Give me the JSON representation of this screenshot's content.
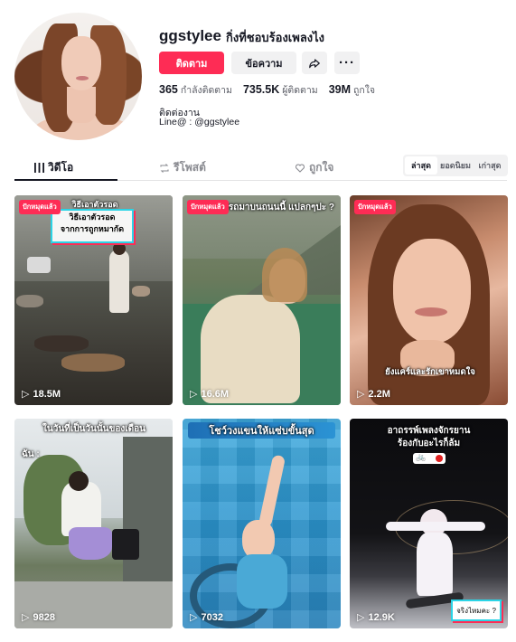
{
  "profile": {
    "username": "ggstylee",
    "nickname": "กิ่งที่ชอบร้องเพลงไง",
    "follow_label": "ติดตาม",
    "message_label": "ข้อความ",
    "stats": {
      "following_count": "365",
      "following_label": "กำลังติดตาม",
      "followers_count": "735.5K",
      "followers_label": "ผู้ติดตาม",
      "likes_count": "39M",
      "likes_label": "ถูกใจ"
    },
    "bio_line1": "ติดต่องาน",
    "bio_line2": "Line@ : @ggstylee"
  },
  "tabs": [
    {
      "label": "วิดีโอ",
      "icon": "grid-icon",
      "active": true
    },
    {
      "label": "รีโพสต์",
      "icon": "repost-icon",
      "active": false
    },
    {
      "label": "ถูกใจ",
      "icon": "heart-lock-icon",
      "active": false
    }
  ],
  "sort": [
    "ล่าสุด",
    "ยอดนิยม",
    "เก่าสุด"
  ],
  "videos": [
    {
      "pinned": "ปักหมุดแล้ว",
      "views": "18.5M",
      "caption": "วิธีเอาตัวรอด\nจากการถูกหมากัด",
      "caption_top": "วิธีเอาตัวรอด"
    },
    {
      "pinned": "ปักหมุดแล้ว",
      "views": "16.6M",
      "caption": "ขับรถมาบนถนนนี้ แปลกๆปะ ?"
    },
    {
      "pinned": "ปักหมุดแล้ว",
      "views": "2.2M",
      "caption": "ยังแคร์และรักเขาหมดใจ"
    },
    {
      "views": "9828",
      "caption": "ในวันที่เป็นวันนั้นของเดือน",
      "caption2": "ฉัน :"
    },
    {
      "views": "7032",
      "caption": "โชว์วงแขนให้แซ่บขั้นสุด"
    },
    {
      "views": "12.9K",
      "caption": "อาถรรพ์เพลงจักรยาน",
      "caption2": "ร้องกับอะไรก็ล้ม",
      "tag": "จริงไหมคะ ?"
    }
  ],
  "colors": {
    "accent": "#fe2c55",
    "text": "#161823",
    "muted": "#5b5d66",
    "button_bg": "#f1f1f2"
  }
}
